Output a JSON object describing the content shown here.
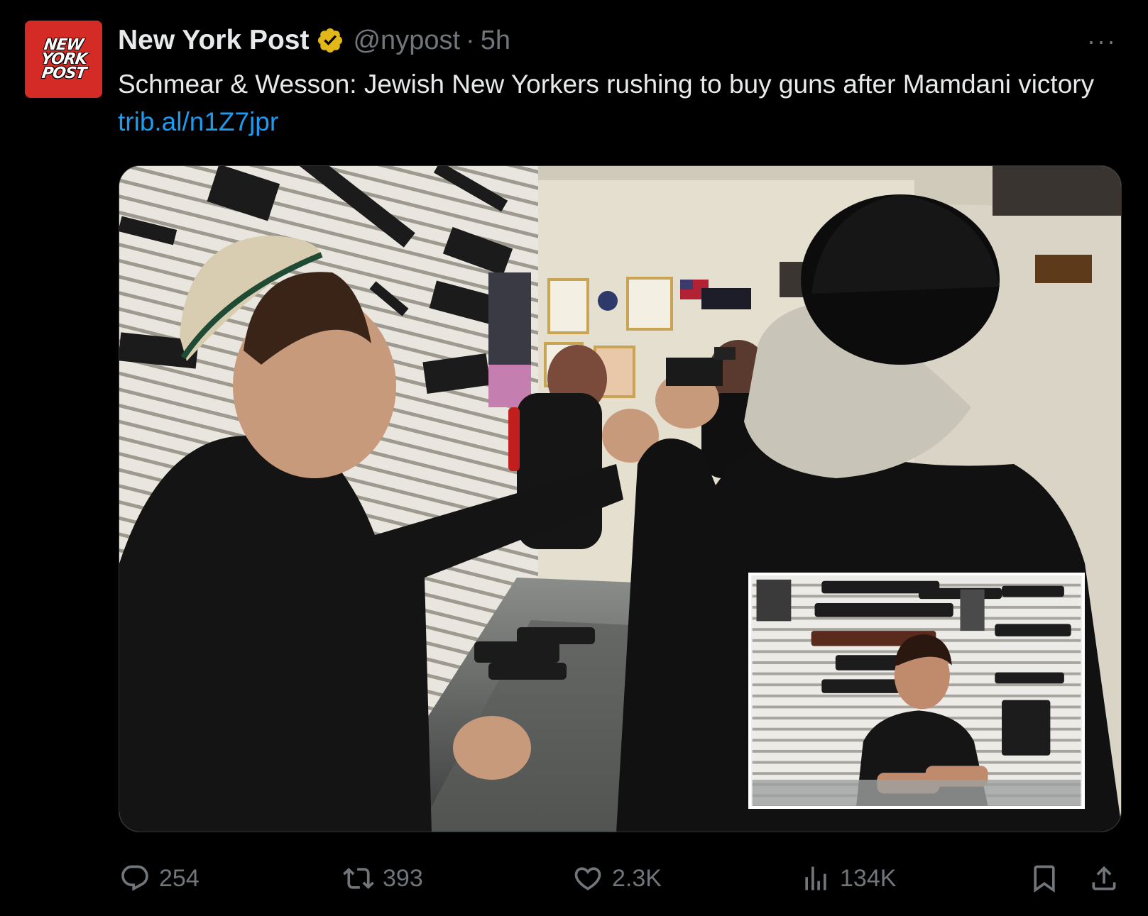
{
  "author": {
    "name": "New York Post",
    "handle": "@nypost",
    "separator": "·",
    "time": "5h",
    "avatar_lines": [
      "NEW",
      "YORK",
      "POST"
    ],
    "verified": true
  },
  "more_menu_label": "···",
  "tweet": {
    "text": "Schmear & Wesson: Jewish New Yorkers rushing to buy guns after Mamdani victory ",
    "link": "trib.al/n1Z7jpr"
  },
  "media": {
    "main_photo": "gun-store-photo",
    "inset_photo": "salesman-portrait-photo"
  },
  "actions": {
    "replies": "254",
    "reposts": "393",
    "likes": "2.3K",
    "views": "134K"
  },
  "colors": {
    "background": "#000000",
    "text_primary": "#e7e9ea",
    "text_secondary": "#71767b",
    "link": "#1d9bf0",
    "avatar_bg": "#d52b27",
    "verified_badge": "#e2b719"
  },
  "icons": [
    "reply-icon",
    "repost-icon",
    "like-icon",
    "views-icon",
    "bookmark-icon",
    "share-icon",
    "verified-badge-icon",
    "more-icon"
  ]
}
